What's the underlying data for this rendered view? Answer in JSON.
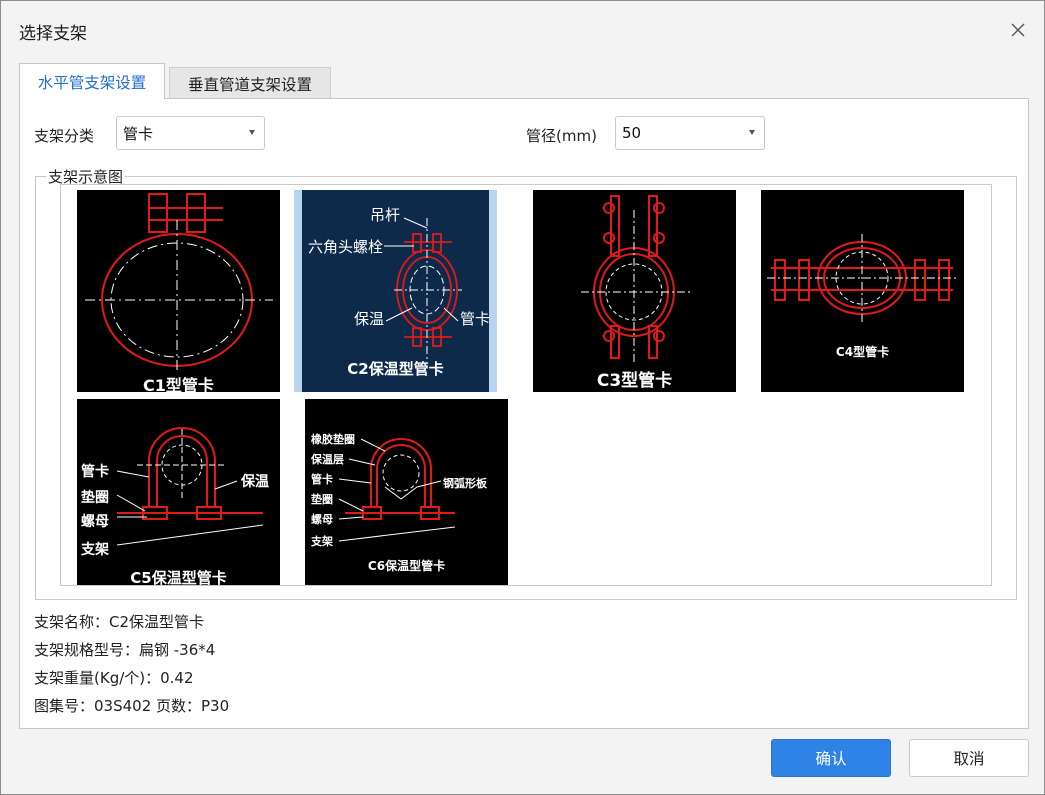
{
  "window": {
    "title": "选择支架"
  },
  "tabs": [
    {
      "label": "水平管支架设置",
      "active": true
    },
    {
      "label": "垂直管道支架设置",
      "active": false
    }
  ],
  "filters": {
    "category_label": "支架分类",
    "category_value": "管卡",
    "diameter_label": "管径(mm)",
    "diameter_value": "50"
  },
  "gallery": {
    "legend": "支架示意图",
    "items": [
      {
        "caption": "C1型管卡",
        "selected": false
      },
      {
        "caption": "C2保温型管卡",
        "selected": true,
        "callouts": [
          "吊杆",
          "六角头螺栓",
          "保温",
          "管卡"
        ]
      },
      {
        "caption": "C3型管卡",
        "selected": false
      },
      {
        "caption": "C4型管卡",
        "selected": false
      },
      {
        "caption": "C5保温型管卡",
        "selected": false,
        "callouts": [
          "管卡",
          "保温",
          "垫圈",
          "螺母",
          "支架"
        ]
      },
      {
        "caption": "C6保温型管卡",
        "selected": false,
        "callouts": [
          "橡胶垫圈",
          "保温层",
          "管卡",
          "钢弧形板",
          "垫圈",
          "螺母",
          "支架"
        ]
      }
    ]
  },
  "details": {
    "name": "支架名称：C2保温型管卡",
    "spec": "支架规格型号：扁钢 -36*4",
    "weight": "支架重量(Kg/个)：0.42",
    "atlas": "图集号：03S402  页数：P30"
  },
  "buttons": {
    "ok": "确认",
    "cancel": "取消"
  },
  "colors": {
    "accent": "#2f83e6",
    "drawing_red": "#e01a1a",
    "selected_bg": "#0d2a4a"
  }
}
